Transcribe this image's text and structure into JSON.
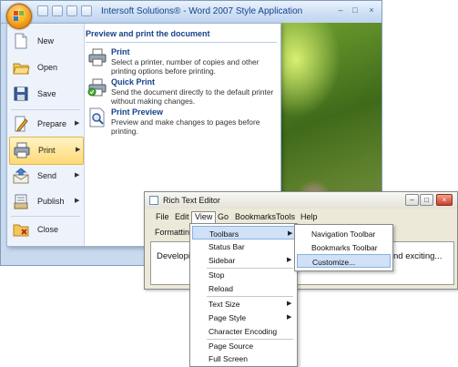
{
  "word": {
    "title": "Intersoft Solutions® - Word 2007 Style Application",
    "window_controls": [
      "–",
      "□",
      "×"
    ],
    "office_menu": {
      "items": [
        {
          "label": "New",
          "icon": "new-document-icon"
        },
        {
          "label": "Open",
          "icon": "open-folder-icon"
        },
        {
          "label": "Save",
          "icon": "save-disk-icon"
        },
        {
          "label": "Prepare",
          "icon": "prepare-icon",
          "has_submenu": true
        },
        {
          "label": "Print",
          "icon": "printer-icon",
          "has_submenu": true,
          "highlighted": true
        },
        {
          "label": "Send",
          "icon": "send-icon",
          "has_submenu": true
        },
        {
          "label": "Publish",
          "icon": "publish-icon",
          "has_submenu": true
        },
        {
          "label": "Close",
          "icon": "close-folder-icon"
        }
      ],
      "panel_title": "Preview and print the document",
      "panel_items": [
        {
          "title": "Print",
          "description": "Select a printer, number of copies and other printing options before printing.",
          "icon": "printer-icon"
        },
        {
          "title": "Quick Print",
          "description": "Send the document directly to the default printer without making changes.",
          "icon": "quick-print-icon"
        },
        {
          "title": "Print Preview",
          "description": "Preview and make changes to pages before printing.",
          "icon": "print-preview-icon"
        }
      ]
    }
  },
  "rte": {
    "title": "Rich Text Editor",
    "menubar": [
      "File",
      "Edit",
      "View",
      "Go",
      "Bookmarks",
      "Tools",
      "Help"
    ],
    "toolbar_label": "Formatting",
    "doc_text_left": "Developing",
    "doc_text_right": "nd exciting...",
    "view_menu": {
      "items": [
        {
          "label": "Toolbars",
          "submenu": true,
          "highlighted": true
        },
        {
          "label": "Status Bar"
        },
        {
          "label": "Sidebar",
          "submenu": true
        },
        {
          "separator": true
        },
        {
          "label": "Stop"
        },
        {
          "label": "Reload"
        },
        {
          "separator": true
        },
        {
          "label": "Text Size",
          "submenu": true
        },
        {
          "label": "Page Style",
          "submenu": true
        },
        {
          "label": "Character Encoding"
        },
        {
          "separator": true
        },
        {
          "label": "Page Source"
        },
        {
          "label": "Full Screen"
        }
      ]
    },
    "toolbars_submenu": {
      "items": [
        {
          "label": "Navigation Toolbar"
        },
        {
          "label": "Bookmarks Toolbar"
        },
        {
          "label": "Customize...",
          "highlighted": true
        }
      ]
    }
  },
  "colors": {
    "ribbon_blue": "#15428b",
    "highlight_gold": "#ffd976",
    "menu_highlight": "#cfe0f7"
  }
}
